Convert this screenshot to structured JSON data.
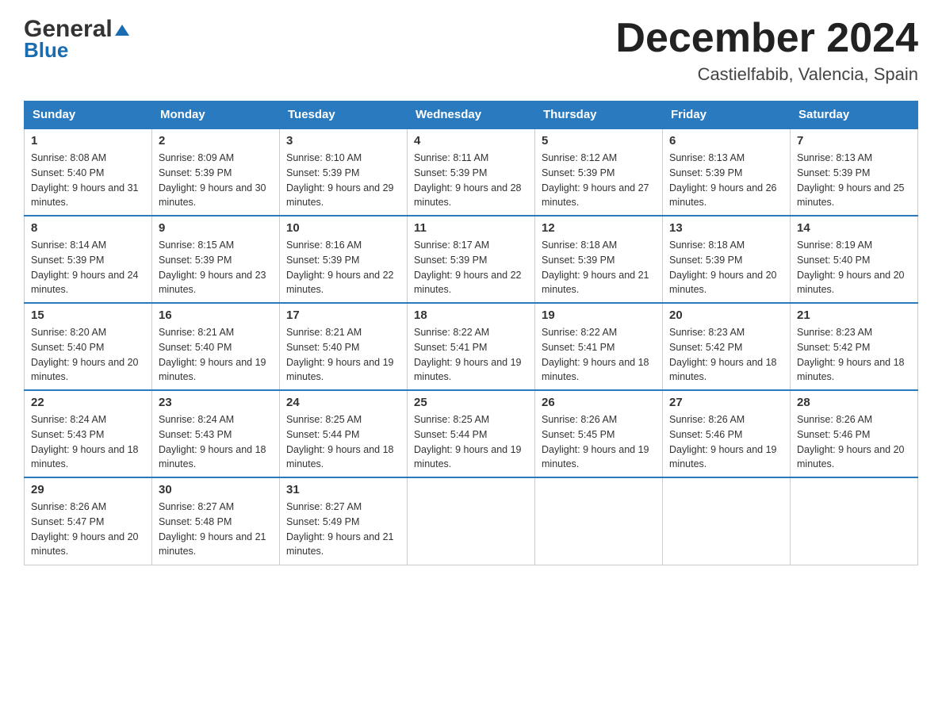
{
  "header": {
    "logo": {
      "line1": "General",
      "line2": "Blue"
    },
    "title": "December 2024",
    "location": "Castielfabib, Valencia, Spain"
  },
  "weekdays": [
    "Sunday",
    "Monday",
    "Tuesday",
    "Wednesday",
    "Thursday",
    "Friday",
    "Saturday"
  ],
  "weeks": [
    [
      {
        "day": "1",
        "sunrise": "8:08 AM",
        "sunset": "5:40 PM",
        "daylight": "9 hours and 31 minutes."
      },
      {
        "day": "2",
        "sunrise": "8:09 AM",
        "sunset": "5:39 PM",
        "daylight": "9 hours and 30 minutes."
      },
      {
        "day": "3",
        "sunrise": "8:10 AM",
        "sunset": "5:39 PM",
        "daylight": "9 hours and 29 minutes."
      },
      {
        "day": "4",
        "sunrise": "8:11 AM",
        "sunset": "5:39 PM",
        "daylight": "9 hours and 28 minutes."
      },
      {
        "day": "5",
        "sunrise": "8:12 AM",
        "sunset": "5:39 PM",
        "daylight": "9 hours and 27 minutes."
      },
      {
        "day": "6",
        "sunrise": "8:13 AM",
        "sunset": "5:39 PM",
        "daylight": "9 hours and 26 minutes."
      },
      {
        "day": "7",
        "sunrise": "8:13 AM",
        "sunset": "5:39 PM",
        "daylight": "9 hours and 25 minutes."
      }
    ],
    [
      {
        "day": "8",
        "sunrise": "8:14 AM",
        "sunset": "5:39 PM",
        "daylight": "9 hours and 24 minutes."
      },
      {
        "day": "9",
        "sunrise": "8:15 AM",
        "sunset": "5:39 PM",
        "daylight": "9 hours and 23 minutes."
      },
      {
        "day": "10",
        "sunrise": "8:16 AM",
        "sunset": "5:39 PM",
        "daylight": "9 hours and 22 minutes."
      },
      {
        "day": "11",
        "sunrise": "8:17 AM",
        "sunset": "5:39 PM",
        "daylight": "9 hours and 22 minutes."
      },
      {
        "day": "12",
        "sunrise": "8:18 AM",
        "sunset": "5:39 PM",
        "daylight": "9 hours and 21 minutes."
      },
      {
        "day": "13",
        "sunrise": "8:18 AM",
        "sunset": "5:39 PM",
        "daylight": "9 hours and 20 minutes."
      },
      {
        "day": "14",
        "sunrise": "8:19 AM",
        "sunset": "5:40 PM",
        "daylight": "9 hours and 20 minutes."
      }
    ],
    [
      {
        "day": "15",
        "sunrise": "8:20 AM",
        "sunset": "5:40 PM",
        "daylight": "9 hours and 20 minutes."
      },
      {
        "day": "16",
        "sunrise": "8:21 AM",
        "sunset": "5:40 PM",
        "daylight": "9 hours and 19 minutes."
      },
      {
        "day": "17",
        "sunrise": "8:21 AM",
        "sunset": "5:40 PM",
        "daylight": "9 hours and 19 minutes."
      },
      {
        "day": "18",
        "sunrise": "8:22 AM",
        "sunset": "5:41 PM",
        "daylight": "9 hours and 19 minutes."
      },
      {
        "day": "19",
        "sunrise": "8:22 AM",
        "sunset": "5:41 PM",
        "daylight": "9 hours and 18 minutes."
      },
      {
        "day": "20",
        "sunrise": "8:23 AM",
        "sunset": "5:42 PM",
        "daylight": "9 hours and 18 minutes."
      },
      {
        "day": "21",
        "sunrise": "8:23 AM",
        "sunset": "5:42 PM",
        "daylight": "9 hours and 18 minutes."
      }
    ],
    [
      {
        "day": "22",
        "sunrise": "8:24 AM",
        "sunset": "5:43 PM",
        "daylight": "9 hours and 18 minutes."
      },
      {
        "day": "23",
        "sunrise": "8:24 AM",
        "sunset": "5:43 PM",
        "daylight": "9 hours and 18 minutes."
      },
      {
        "day": "24",
        "sunrise": "8:25 AM",
        "sunset": "5:44 PM",
        "daylight": "9 hours and 18 minutes."
      },
      {
        "day": "25",
        "sunrise": "8:25 AM",
        "sunset": "5:44 PM",
        "daylight": "9 hours and 19 minutes."
      },
      {
        "day": "26",
        "sunrise": "8:26 AM",
        "sunset": "5:45 PM",
        "daylight": "9 hours and 19 minutes."
      },
      {
        "day": "27",
        "sunrise": "8:26 AM",
        "sunset": "5:46 PM",
        "daylight": "9 hours and 19 minutes."
      },
      {
        "day": "28",
        "sunrise": "8:26 AM",
        "sunset": "5:46 PM",
        "daylight": "9 hours and 20 minutes."
      }
    ],
    [
      {
        "day": "29",
        "sunrise": "8:26 AM",
        "sunset": "5:47 PM",
        "daylight": "9 hours and 20 minutes."
      },
      {
        "day": "30",
        "sunrise": "8:27 AM",
        "sunset": "5:48 PM",
        "daylight": "9 hours and 21 minutes."
      },
      {
        "day": "31",
        "sunrise": "8:27 AM",
        "sunset": "5:49 PM",
        "daylight": "9 hours and 21 minutes."
      },
      null,
      null,
      null,
      null
    ]
  ],
  "labels": {
    "sunrise": "Sunrise:",
    "sunset": "Sunset:",
    "daylight": "Daylight:"
  }
}
